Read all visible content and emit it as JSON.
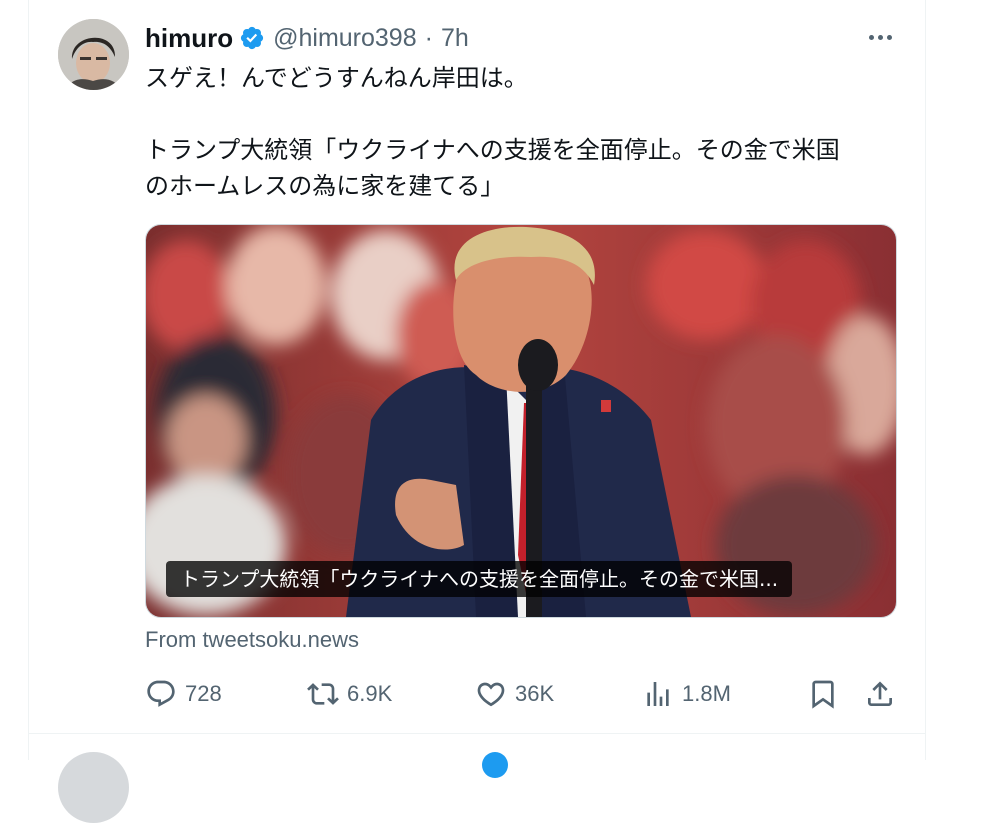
{
  "tweet": {
    "author": {
      "name": "himuro",
      "verified": true,
      "handle": "@himuro398",
      "separator": "·",
      "time": "7h"
    },
    "text_lines": [
      "スゲえ！んでどうすんねん岸田は。",
      "トランプ大統領「ウクライナへの支援を全面停止。その金で米国",
      "のホームレスの為に家を建てる」"
    ],
    "card": {
      "caption": "トランプ大統領「ウクライナへの支援を全面停止。その金で米国...",
      "source": "From tweetsoku.news"
    },
    "actions": {
      "replies": "728",
      "reposts": "6.9K",
      "likes": "36K",
      "views": "1.8M"
    },
    "icons": {
      "reply": "reply-icon",
      "repost": "repost-icon",
      "like": "heart-icon",
      "views": "views-icon",
      "bookmark": "bookmark-icon",
      "share": "share-icon",
      "more": "more-icon",
      "verified": "verified-badge-icon"
    },
    "colors": {
      "verified": "#1d9bf0",
      "secondary_text": "#536471",
      "primary_text": "#0f1419"
    }
  }
}
